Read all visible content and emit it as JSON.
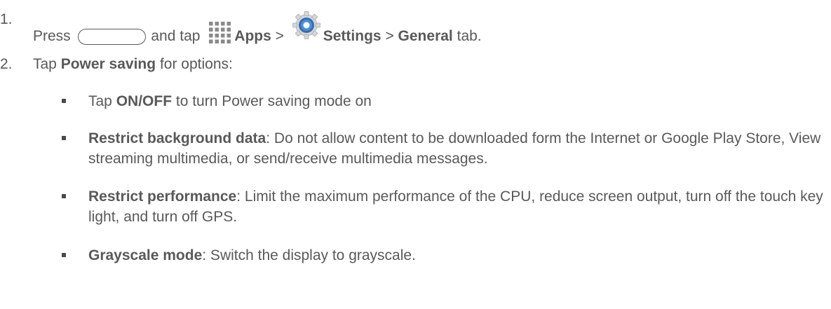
{
  "steps": [
    {
      "number": "1.",
      "press": "Press",
      "and_tap": "and tap",
      "apps": "Apps",
      "sep1": ">",
      "settings": "Settings",
      "sep2": ">",
      "general": "General",
      "tab": "tab."
    },
    {
      "number": "2.",
      "tap": "Tap",
      "power_saving": "Power saving",
      "for_options": "for options:"
    }
  ],
  "bullets": [
    {
      "pre": "Tap ",
      "bold": "ON/OFF",
      "rest": " to turn Power saving mode on"
    },
    {
      "pre": "",
      "bold": "Restrict background data",
      "rest": ": Do not allow content to be downloaded form the Internet or Google Play Store, View streaming multimedia, or send/receive multimedia messages."
    },
    {
      "pre": "",
      "bold": "Restrict performance",
      "rest": ": Limit the maximum performance of the CPU, reduce screen output, turn off the touch key light, and turn off GPS."
    },
    {
      "pre": "",
      "bold": "Grayscale mode",
      "rest": ": Switch the display to grayscale."
    }
  ],
  "icons": {
    "home": "home-button-icon",
    "apps": "apps-grid-icon",
    "settings": "settings-gear-icon"
  },
  "colors": {
    "text": "#595959",
    "settings_blue": "#2f6fb8"
  }
}
